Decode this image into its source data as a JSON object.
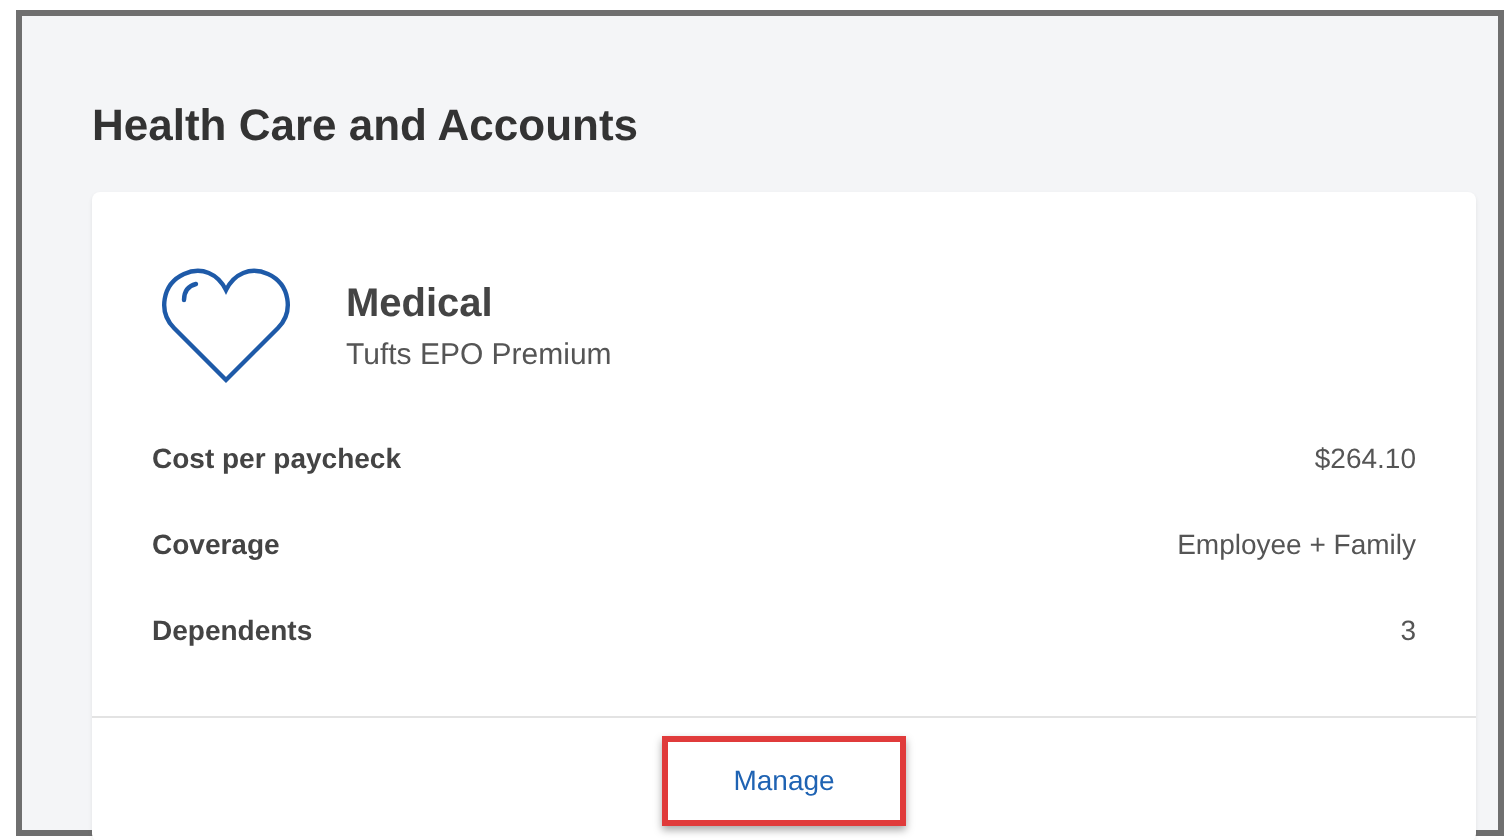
{
  "section": {
    "title": "Health Care and Accounts"
  },
  "plan": {
    "name": "Medical",
    "subtitle": "Tufts EPO Premium"
  },
  "details": [
    {
      "label": "Cost per paycheck",
      "value": "$264.10"
    },
    {
      "label": "Coverage",
      "value": "Employee + Family"
    },
    {
      "label": "Dependents",
      "value": "3"
    }
  ],
  "action": {
    "label": "Manage",
    "highlighted": true
  }
}
